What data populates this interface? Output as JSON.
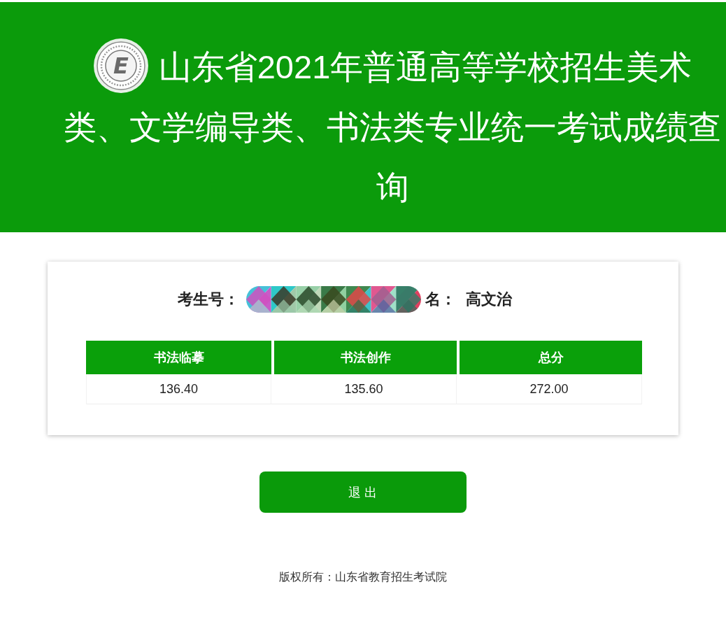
{
  "header": {
    "logo": {
      "letter": "E"
    },
    "title_lines": [
      "山东省2021年普通高等学校招生美术",
      "类、文学编导类、书法类专业统一考试成绩查",
      "询"
    ]
  },
  "candidate": {
    "id_label": "考生号：",
    "id_redacted": true,
    "name_label": "名：",
    "name": "高文治"
  },
  "scores": {
    "columns": [
      "书法临摹",
      "书法创作",
      "总分"
    ],
    "rows": [
      [
        "136.40",
        "135.60",
        "272.00"
      ]
    ]
  },
  "exit_button": {
    "label": "退 出"
  },
  "footer": {
    "copyright": "版权所有：山东省教育招生考试院"
  }
}
